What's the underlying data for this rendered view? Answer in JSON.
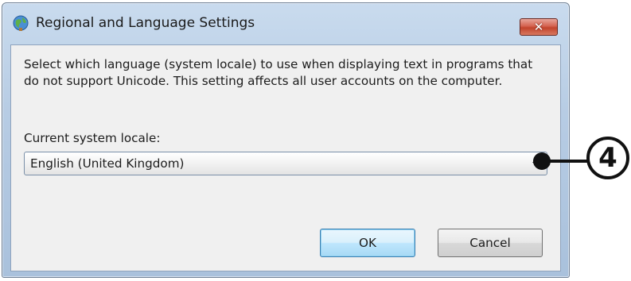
{
  "window": {
    "title": "Regional and Language Settings",
    "icon": "globe-icon",
    "close_icon": "close-icon",
    "close_glyph": "✕"
  },
  "content": {
    "description": "Select which language (system locale) to use when displaying text in programs that do not support Unicode. This setting affects all user accounts on the computer.",
    "locale_label": "Current system locale:",
    "locale_value": "English (United Kingdom)"
  },
  "buttons": {
    "ok_label": "OK",
    "cancel_label": "Cancel"
  },
  "annotation": {
    "marker": "4"
  },
  "colors": {
    "titlebar": "#b7cce4",
    "client_bg": "#f0f0f0",
    "close_button": "#c2432c",
    "ok_focus": "#3c7fb1",
    "callout": "#111111"
  }
}
